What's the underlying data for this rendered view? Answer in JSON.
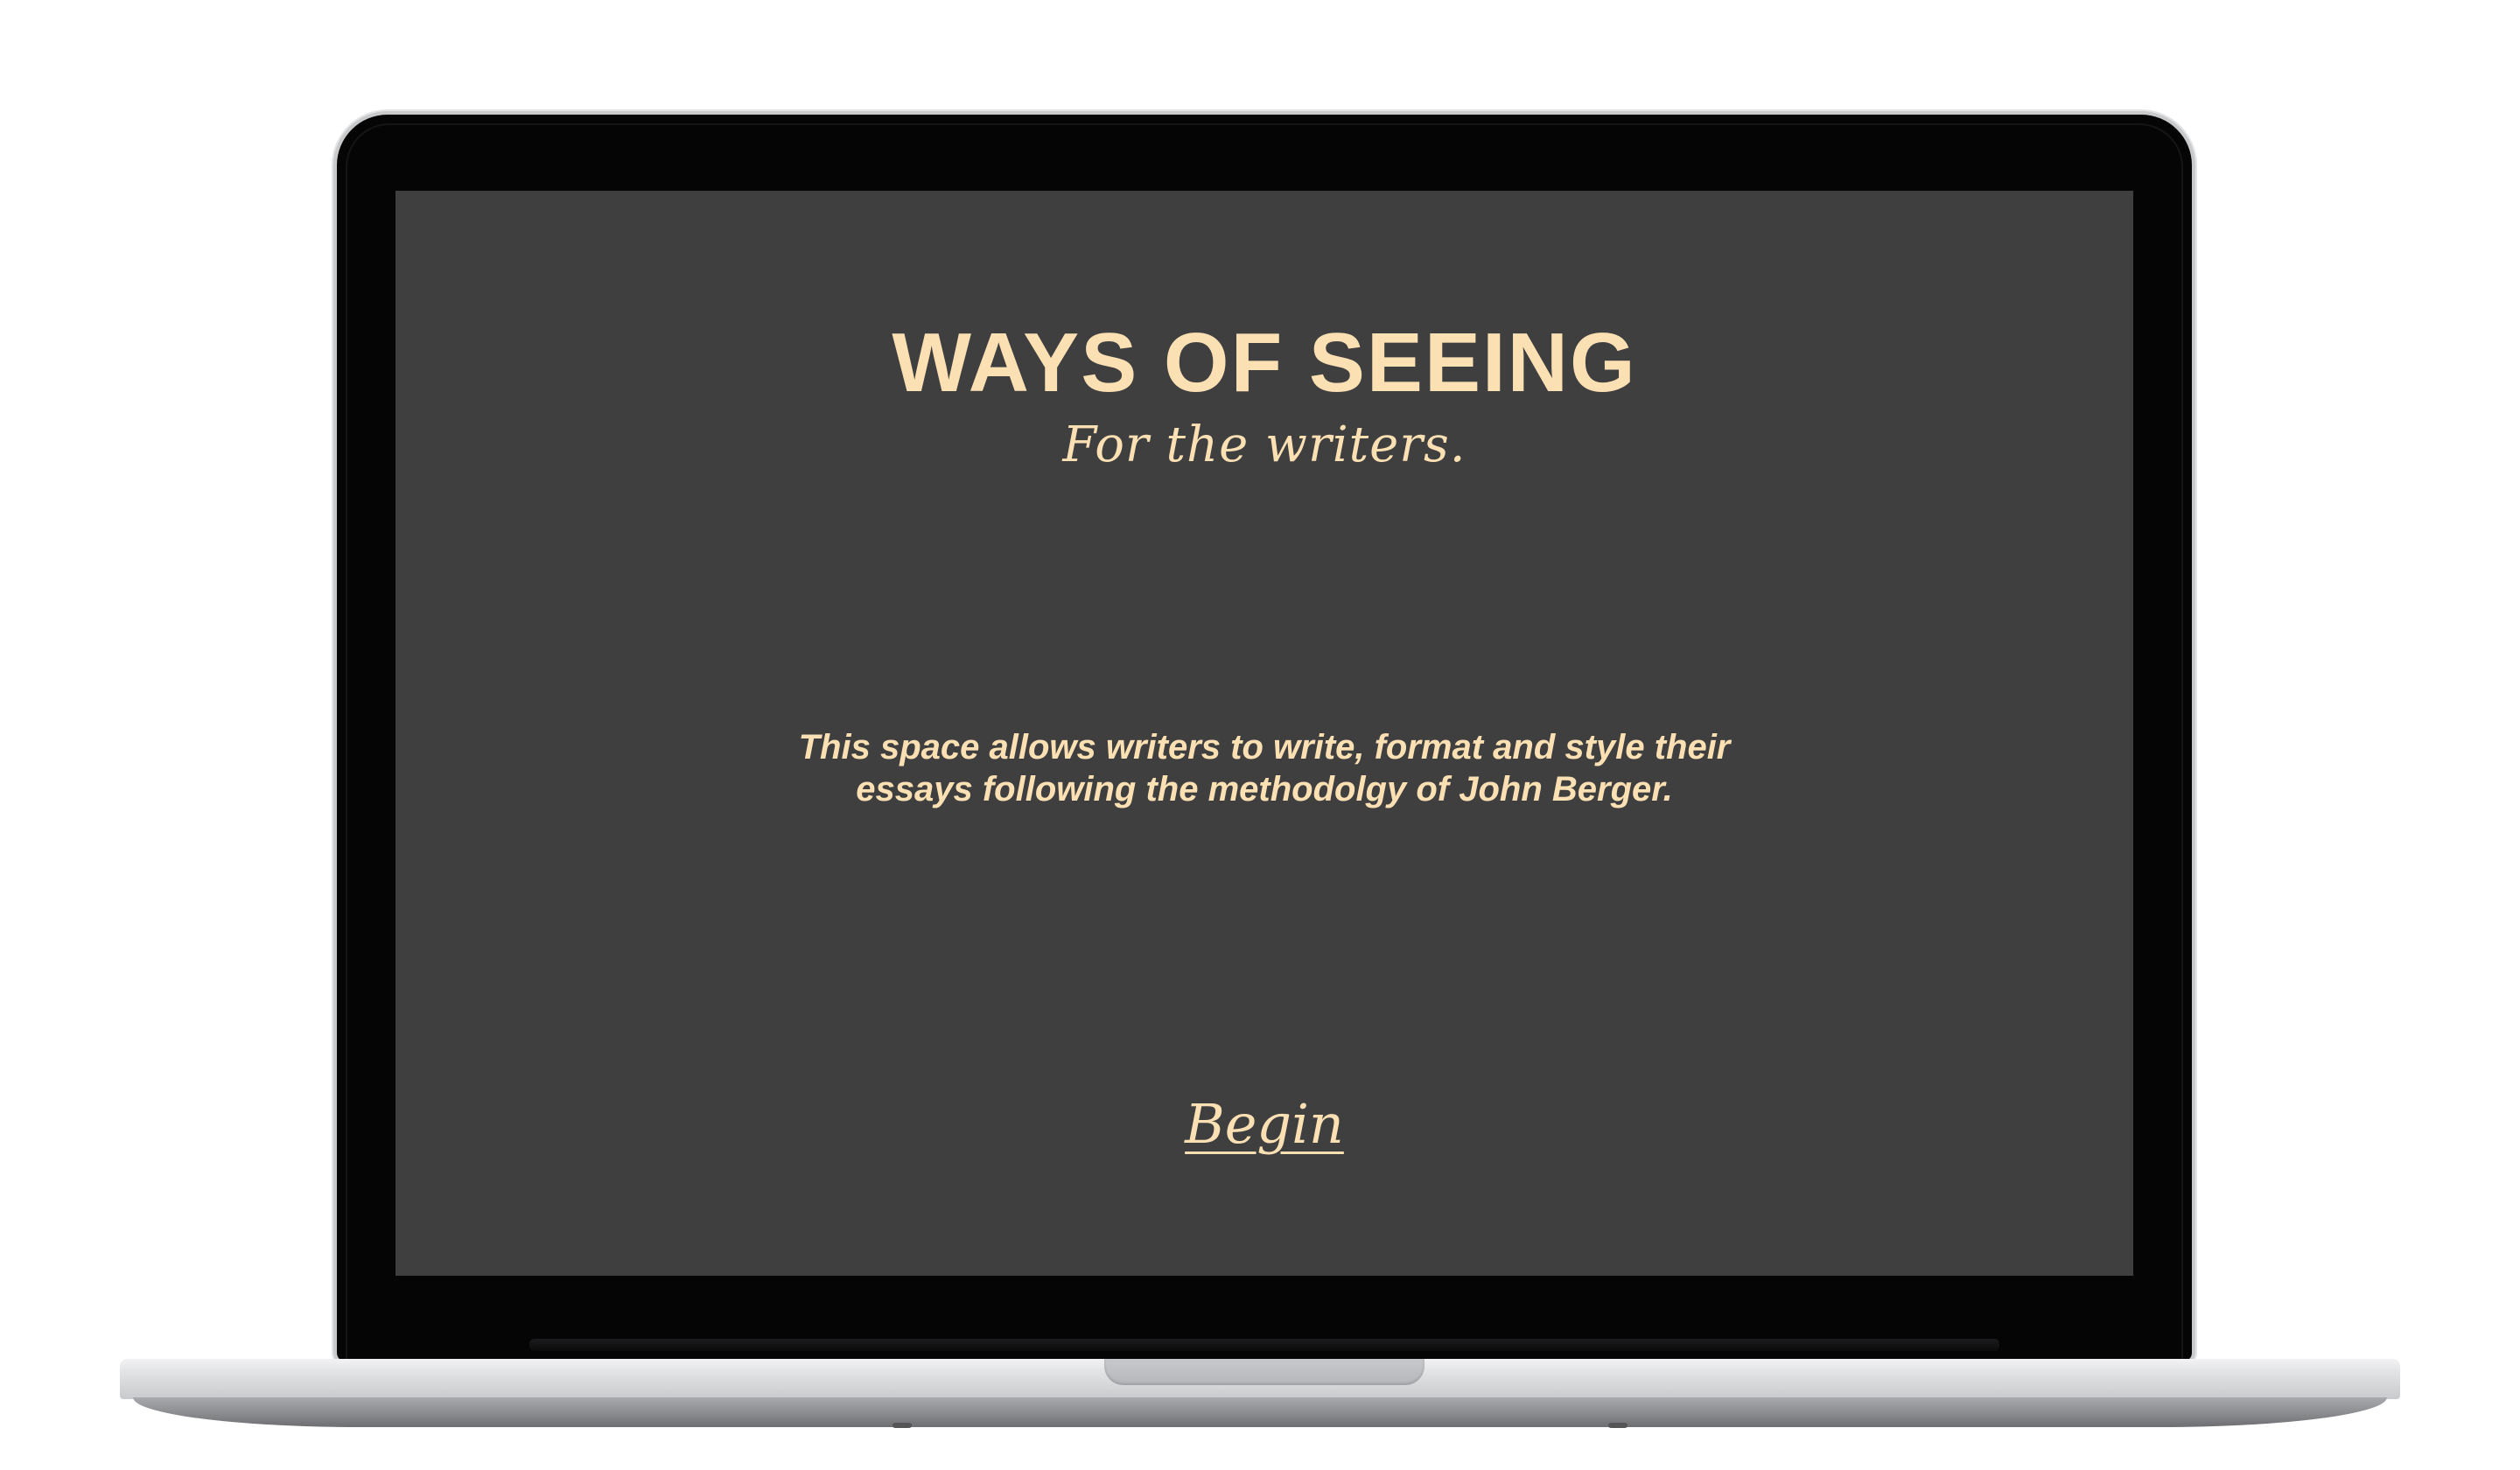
{
  "screen": {
    "title": "WAYS OF SEEING",
    "subtitle": "For the writers.",
    "description": "This space allows writers to write, format and style their essays following the methodolgy of John Berger.",
    "begin_label": "Begin"
  },
  "colors": {
    "screen_background": "#3f3f3f",
    "text_accent": "#fbe0b4",
    "bezel": "#050506",
    "page_background": "#ffffff"
  }
}
